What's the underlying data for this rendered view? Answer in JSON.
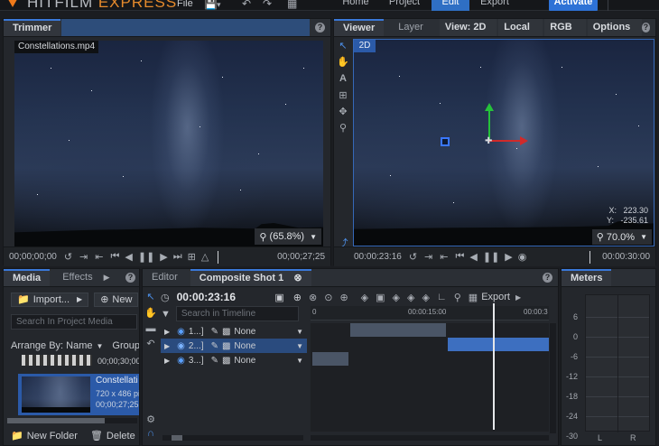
{
  "topbar": {
    "brand_left": "HITFILM",
    "brand_right": "EXPRESS",
    "file_label": "File",
    "nav": [
      "Home",
      "Project",
      "Edit",
      "Export"
    ],
    "activate_label": "Activate",
    "icons": [
      "save-icon",
      "undo-icon",
      "redo-icon",
      "grid-icon"
    ]
  },
  "trimmer": {
    "tab": "Trimmer",
    "file_label": "Constellations.mp4",
    "timecode_in": "00;00;00;00",
    "timecode_out": "00;00;27;25",
    "zoom": "(65.8%)"
  },
  "viewer": {
    "tabs": [
      "Viewer",
      "Layer"
    ],
    "view_label": "View: 2D",
    "space_label": "Local",
    "channel_label": "RGB",
    "options_label": "Options",
    "badge_2d": "2D",
    "coords": {
      "x_label": "X:",
      "x_value": "223.30",
      "y_label": "Y:",
      "y_value": "-235.61"
    },
    "timecode_current": "00:00:23:16",
    "timecode_end": "00:00:30:00",
    "zoom": "70.0%",
    "accent_color": "#2f6fc4"
  },
  "media": {
    "tabs": [
      "Media",
      "Effects"
    ],
    "import_label": "Import...",
    "new_label": "New",
    "search_placeholder": "Search In Project Media",
    "arrange_label": "Arrange By: Name",
    "group_label": "Group B",
    "items": [
      {
        "name": "",
        "duration": "00;00;30;00"
      },
      {
        "name": "Constellati",
        "dimensions": "720 x 486 pi",
        "duration": "00;00;27;25"
      }
    ],
    "new_folder_label": "New Folder",
    "delete_label": "Delete"
  },
  "editor": {
    "tabs": [
      "Editor",
      "Composite Shot 1"
    ],
    "timecode": "00:00:23:16",
    "search_placeholder": "Search in Timeline",
    "export_label": "Export",
    "ruler": [
      "0",
      "00:00:15:00",
      "00:00:3"
    ],
    "layers": [
      {
        "label": "1...]",
        "blend": "None"
      },
      {
        "label": "2...]",
        "blend": "None"
      },
      {
        "label": "3...]",
        "blend": "None"
      }
    ]
  },
  "meters": {
    "tab": "Meters",
    "scale": [
      "6",
      "0",
      "-6",
      "-12",
      "-18",
      "-24",
      "-30"
    ],
    "channels": [
      "L",
      "R"
    ]
  }
}
